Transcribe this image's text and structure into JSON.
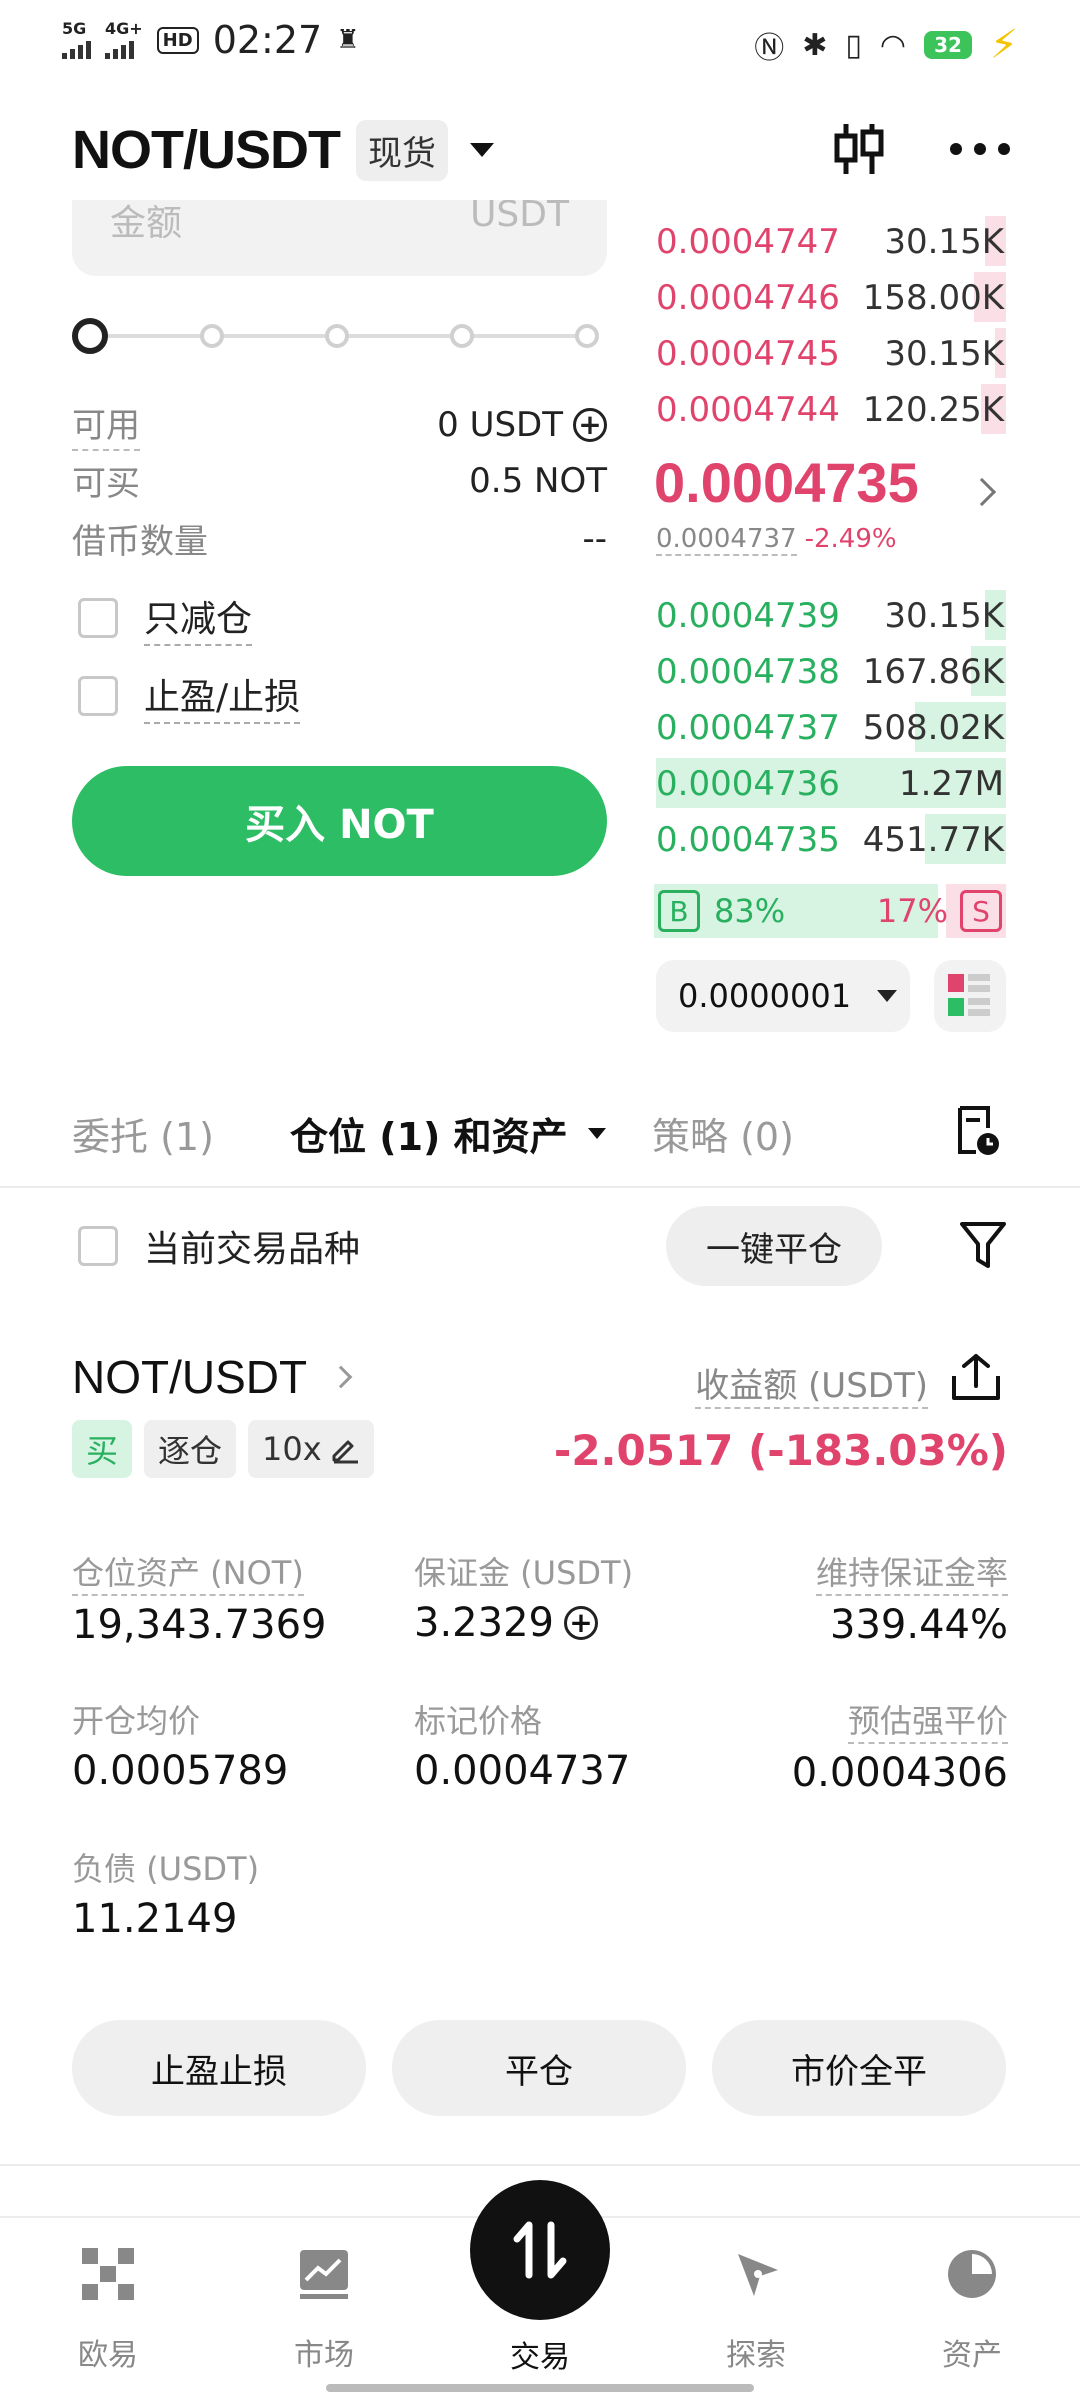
{
  "status_bar": {
    "network_1": "5G",
    "network_2": "4G+",
    "hd_label": "HD",
    "time": "02:27",
    "battery": "32"
  },
  "header": {
    "pair": "NOT/USDT",
    "market_type": "现货"
  },
  "order_form": {
    "amount_placeholder": "金额",
    "amount_unit": "USDT",
    "available_label": "可用",
    "available_value": "0 USDT",
    "can_buy_label": "可买",
    "can_buy_value": "0.5 NOT",
    "borrow_label": "借币数量",
    "borrow_value": "--",
    "reduce_only": "只减仓",
    "tp_sl": "止盈/止损",
    "buy_button": "买入 NOT"
  },
  "order_book": {
    "asks": [
      {
        "price": "0.0004747",
        "qty": "30.15K",
        "depth": 0.06
      },
      {
        "price": "0.0004746",
        "qty": "158.00K",
        "depth": 0.09
      },
      {
        "price": "0.0004745",
        "qty": "30.15K",
        "depth": 0.03
      },
      {
        "price": "0.0004744",
        "qty": "120.25K",
        "depth": 0.07
      }
    ],
    "last_price": "0.0004735",
    "mark_price": "0.0004737",
    "change": "-2.49%",
    "bids": [
      {
        "price": "0.0004739",
        "qty": "30.15K",
        "depth": 0.06
      },
      {
        "price": "0.0004738",
        "qty": "167.86K",
        "depth": 0.1
      },
      {
        "price": "0.0004737",
        "qty": "508.02K",
        "depth": 0.26
      },
      {
        "price": "0.0004736",
        "qty": "1.27M",
        "depth": 1.0
      },
      {
        "price": "0.0004735",
        "qty": "451.77K",
        "depth": 0.23
      }
    ],
    "buy_label": "B",
    "buy_pct": "83%",
    "sell_pct": "17%",
    "sell_label": "S",
    "buy_ratio": 0.83,
    "precision": "0.0000001"
  },
  "tabs": {
    "orders": "委托 (1)",
    "positions": "仓位 (1) 和资产",
    "strategies": "策略 (0)"
  },
  "filter": {
    "current_symbol": "当前交易品种",
    "close_all": "一键平仓"
  },
  "position": {
    "pair": "NOT/USDT",
    "pnl_label": "收益额 (USDT)",
    "side": "买",
    "margin_mode": "逐仓",
    "leverage": "10x",
    "pnl_value": "-2.0517 (-183.03%)",
    "metrics": {
      "pos_asset_label": "仓位资产 (NOT)",
      "pos_asset_value": "19,343.7369",
      "margin_label": "保证金 (USDT)",
      "margin_value": "3.2329",
      "mmr_label": "维持保证金率",
      "mmr_value": "339.44%",
      "entry_label": "开仓均价",
      "entry_value": "0.0005789",
      "mark_label": "标记价格",
      "mark_value": "0.0004737",
      "liq_label": "预估强平价",
      "liq_value": "0.0004306",
      "debt_label": "负债 (USDT)",
      "debt_value": "11.2149"
    },
    "actions": {
      "tp_sl": "止盈止损",
      "close": "平仓",
      "market_close_all": "市价全平"
    }
  },
  "bottom_nav": {
    "home": "欧易",
    "markets": "市场",
    "trade": "交易",
    "discover": "探索",
    "assets": "资产"
  },
  "colors": {
    "buy_green": "#2dbd64",
    "sell_red": "#e0446d"
  }
}
